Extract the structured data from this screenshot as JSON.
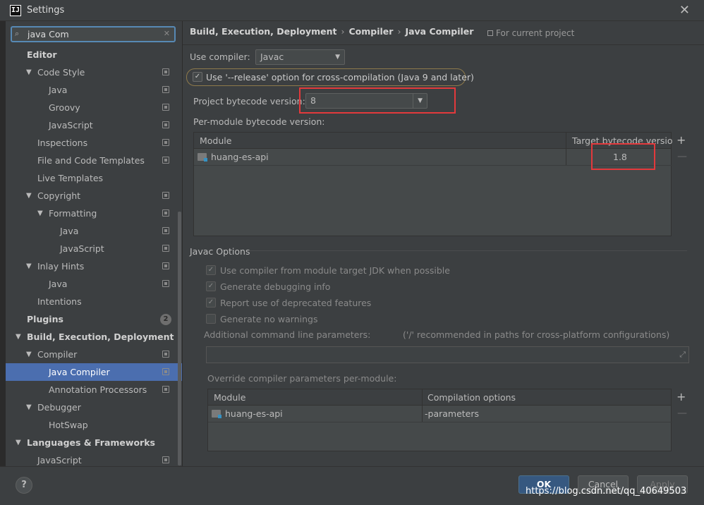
{
  "window": {
    "title": "Settings",
    "app_icon": "IJ",
    "close": "✕"
  },
  "search": {
    "value": "java Com",
    "placeholder": ""
  },
  "tree": [
    {
      "label": "Editor",
      "level": 0,
      "bold": true,
      "arrow": ""
    },
    {
      "label": "Code Style",
      "level": 1,
      "arrow": "▼",
      "proj": true
    },
    {
      "label": "Java",
      "level": 2,
      "arrow": "",
      "proj": true
    },
    {
      "label": "Groovy",
      "level": 2,
      "arrow": "",
      "proj": true
    },
    {
      "label": "JavaScript",
      "level": 2,
      "arrow": "",
      "proj": true
    },
    {
      "label": "Inspections",
      "level": 1,
      "arrow": "",
      "proj": true
    },
    {
      "label": "File and Code Templates",
      "level": 1,
      "arrow": "",
      "proj": true
    },
    {
      "label": "Live Templates",
      "level": 1,
      "arrow": ""
    },
    {
      "label": "Copyright",
      "level": 1,
      "arrow": "▼",
      "proj": true
    },
    {
      "label": "Formatting",
      "level": 2,
      "arrow": "▼",
      "proj": true
    },
    {
      "label": "Java",
      "level": 3,
      "arrow": "",
      "proj": true
    },
    {
      "label": "JavaScript",
      "level": 3,
      "arrow": "",
      "proj": true
    },
    {
      "label": "Inlay Hints",
      "level": 1,
      "arrow": "▼",
      "proj": true
    },
    {
      "label": "Java",
      "level": 2,
      "arrow": "",
      "proj": true
    },
    {
      "label": "Intentions",
      "level": 1,
      "arrow": ""
    },
    {
      "label": "Plugins",
      "level": 0,
      "bold": true,
      "arrow": "",
      "badge": "2"
    },
    {
      "label": "Build, Execution, Deployment",
      "level": 0,
      "bold": true,
      "arrow": "▼"
    },
    {
      "label": "Compiler",
      "level": 1,
      "arrow": "▼",
      "proj": true
    },
    {
      "label": "Java Compiler",
      "level": 2,
      "arrow": "",
      "proj": true,
      "selected": true
    },
    {
      "label": "Annotation Processors",
      "level": 2,
      "arrow": "",
      "proj": true
    },
    {
      "label": "Debugger",
      "level": 1,
      "arrow": "▼"
    },
    {
      "label": "HotSwap",
      "level": 2,
      "arrow": ""
    },
    {
      "label": "Languages & Frameworks",
      "level": 0,
      "bold": true,
      "arrow": "▼"
    },
    {
      "label": "JavaScript",
      "level": 1,
      "arrow": "",
      "proj": true
    }
  ],
  "breadcrumb": {
    "part1": "Build, Execution, Deployment",
    "part2": "Compiler",
    "part3": "Java Compiler",
    "sep": "›"
  },
  "for_project": "For current project",
  "compiler": {
    "use_compiler_label": "Use compiler:",
    "use_compiler_value": "Javac",
    "release_option_label": "Use '--release' option for cross-compilation (Java 9 and later)",
    "release_option_checked": true,
    "bytecode_label": "Project bytecode version:",
    "bytecode_value": "8",
    "per_module_label": "Per-module bytecode version:"
  },
  "module_table": {
    "headers": [
      "Module",
      "Target bytecode version"
    ],
    "rows": [
      {
        "module": "huang-es-api",
        "target": "1.8"
      }
    ]
  },
  "javac": {
    "section_title": "Javac Options",
    "options": [
      {
        "label": "Use compiler from module target JDK when possible",
        "checked": true
      },
      {
        "label": "Generate debugging info",
        "checked": true
      },
      {
        "label": "Report use of deprecated features",
        "checked": true
      },
      {
        "label": "Generate no warnings",
        "checked": false
      }
    ],
    "cmdline_label": "Additional command line parameters:",
    "cmdline_hint": "('/' recommended in paths for cross-platform configurations)",
    "cmdline_value": "",
    "override_label": "Override compiler parameters per-module:"
  },
  "override_table": {
    "headers": [
      "Module",
      "Compilation options"
    ],
    "rows": [
      {
        "module": "huang-es-api",
        "options": "-parameters"
      }
    ]
  },
  "icons": {
    "check": "✓",
    "plus": "+",
    "minus": "—",
    "caret": "▼",
    "search": "⌕",
    "clear": "✕",
    "expand": "⤢"
  },
  "buttons": {
    "help": "?",
    "ok": "OK",
    "cancel": "Cancel",
    "apply": "Apply"
  },
  "watermark": "https://blog.csdn.net/qq_40649503",
  "colors": {
    "accent": "#4b6eaf",
    "highlight": "#e3393c",
    "ok": "#365880"
  }
}
